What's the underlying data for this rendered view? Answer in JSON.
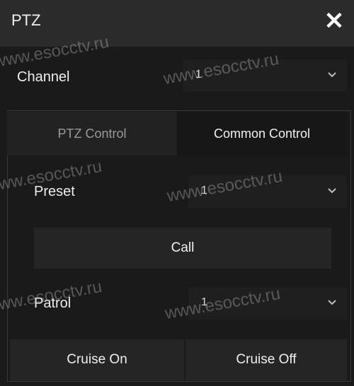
{
  "title": "PTZ",
  "channel": {
    "label": "Channel",
    "value": "1"
  },
  "tabs": [
    {
      "label": "PTZ Control",
      "active": false
    },
    {
      "label": "Common Control",
      "active": true
    }
  ],
  "preset": {
    "label": "Preset",
    "value": "1"
  },
  "call_button": "Call",
  "patrol": {
    "label": "Patrol",
    "value": "1"
  },
  "cruise_on_button": "Cruise On",
  "cruise_off_button": "Cruise Off",
  "watermark": "www.esocctv.ru",
  "icons": {
    "close": "close-icon",
    "dropdown": "chevron-down-icon"
  }
}
